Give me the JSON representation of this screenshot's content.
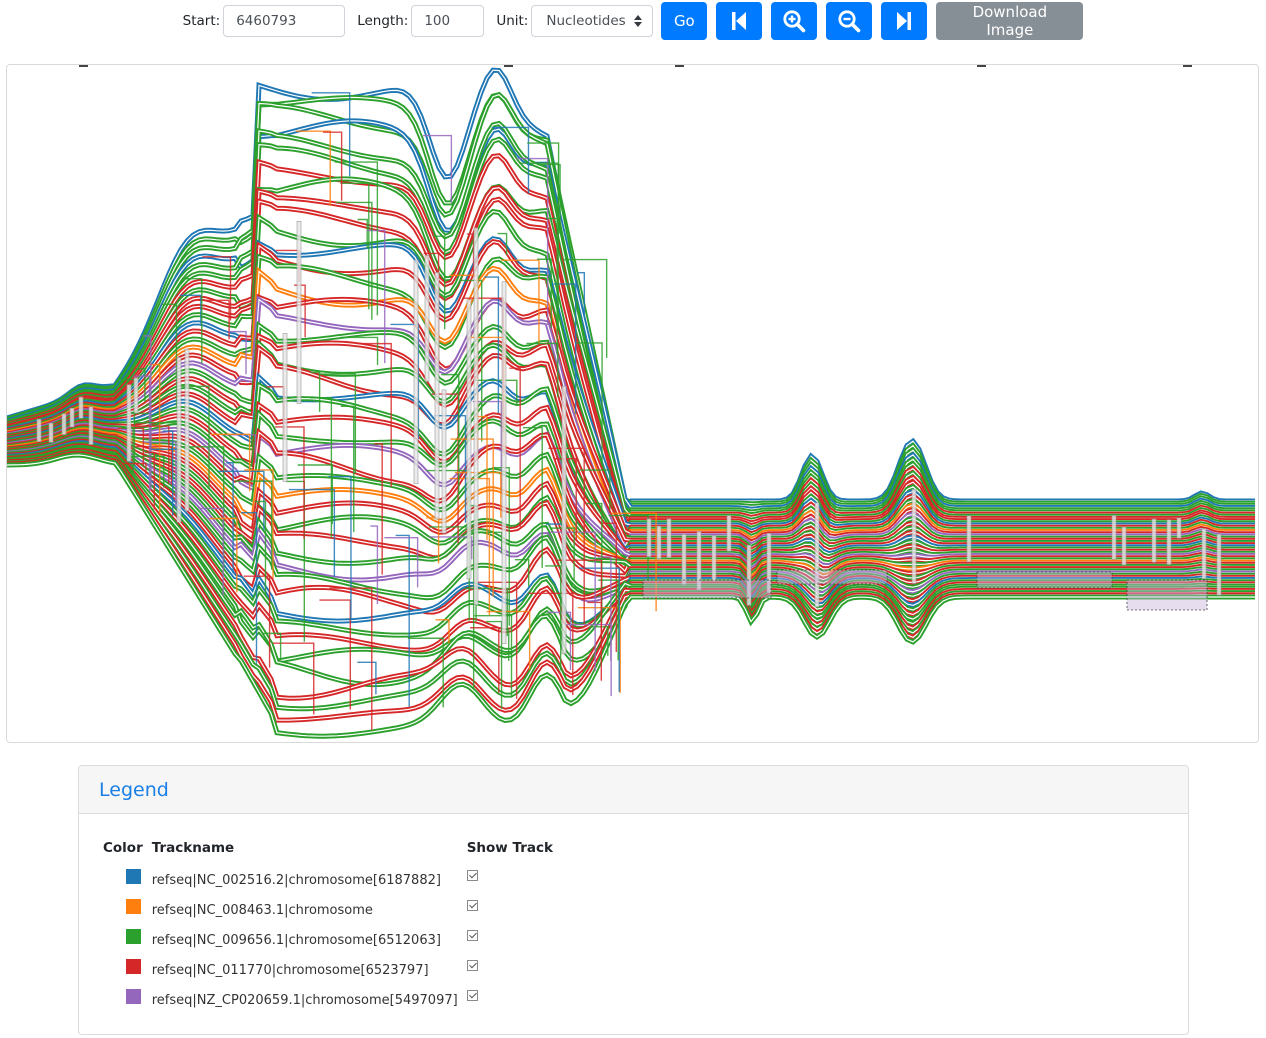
{
  "toolbar": {
    "start_label": "Start:",
    "start_value": "6460793",
    "length_label": "Length:",
    "length_value": "100",
    "unit_label": "Unit:",
    "unit_value": "Nucleotides",
    "go_label": "Go",
    "download_label": "Download Image",
    "icons": {
      "prev": "skip-backward-icon",
      "zoom_in": "zoom-in-icon",
      "zoom_out": "zoom-out-icon",
      "next": "skip-forward-icon"
    }
  },
  "graph": {
    "type": "sequence-tube-map",
    "track_colors": [
      "#1f77b4",
      "#ff7f0e",
      "#2ca02c",
      "#d62728",
      "#9467bd"
    ]
  },
  "legend": {
    "title": "Legend",
    "columns": [
      "Color",
      "Trackname",
      "Show Track"
    ],
    "tracks": [
      {
        "color": "#1f77b4",
        "name": "refseq|NC_002516.2|chromosome[6187882]",
        "shown": true
      },
      {
        "color": "#ff7f0e",
        "name": "refseq|NC_008463.1|chromosome",
        "shown": true
      },
      {
        "color": "#2ca02c",
        "name": "refseq|NC_009656.1|chromosome[6512063]",
        "shown": true
      },
      {
        "color": "#d62728",
        "name": "refseq|NC_011770|chromosome[6523797]",
        "shown": true
      },
      {
        "color": "#9467bd",
        "name": "refseq|NZ_CP020659.1|chromosome[5497097]",
        "shown": true
      }
    ]
  }
}
